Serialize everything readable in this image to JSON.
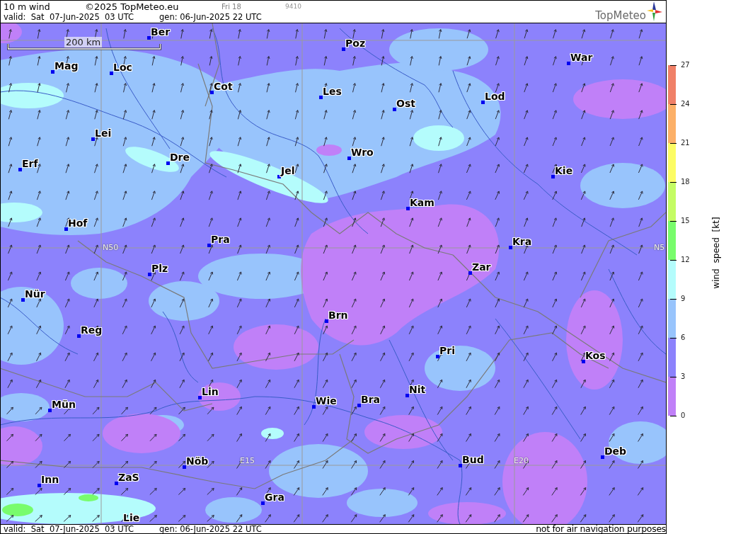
{
  "header": {
    "title": "10 m wind",
    "copyright": "©2025 TopMeteo.eu",
    "run_label": "Fri 18",
    "code": "9410",
    "valid": "valid:  Sat  07-Jun-2025  03 UTC",
    "generated": "gen: 06-Jun-2025 22 UTC",
    "logo": "TopMeteo"
  },
  "map": {
    "scale": "200 km",
    "grid_labels": [
      "N50",
      "N5",
      "E15",
      "E20"
    ],
    "cities": [
      "Ber",
      "Poz",
      "War",
      "Mag",
      "Loc",
      "Cot",
      "Les",
      "Ost",
      "Lod",
      "Lei",
      "Erf",
      "Dre",
      "Wro",
      "Jel",
      "Kie",
      "Kam",
      "Hof",
      "Pra",
      "Kra",
      "Zar",
      "Plz",
      "Nür",
      "Brn",
      "Reg",
      "Pri",
      "Kos",
      "Lin",
      "Mün",
      "Wie",
      "Bra",
      "Nit",
      "Deb",
      "Nöb",
      "Bud",
      "Inn",
      "ZaS",
      "Gra",
      "Lie"
    ]
  },
  "colorbar": {
    "title": "wind speed [kt]",
    "ticks": [
      "27",
      "24",
      "21",
      "18",
      "15",
      "12",
      "9",
      "6",
      "3",
      "0"
    ],
    "bands": [
      {
        "color": "#f08068"
      },
      {
        "color": "#fcb068"
      },
      {
        "color": "#fcfc64"
      },
      {
        "color": "#c4fc64"
      },
      {
        "color": "#78fc6c"
      },
      {
        "color": "#b4fcfc"
      },
      {
        "color": "#98c4fc"
      },
      {
        "color": "#8c82fc"
      },
      {
        "color": "#c080f8"
      }
    ]
  },
  "footer": {
    "valid": "valid:  Sat  07-Jun-2025  03 UTC",
    "generated": "gen: 06-Jun-2025 22 UTC",
    "disclaimer": "not for air navigation purposes"
  }
}
